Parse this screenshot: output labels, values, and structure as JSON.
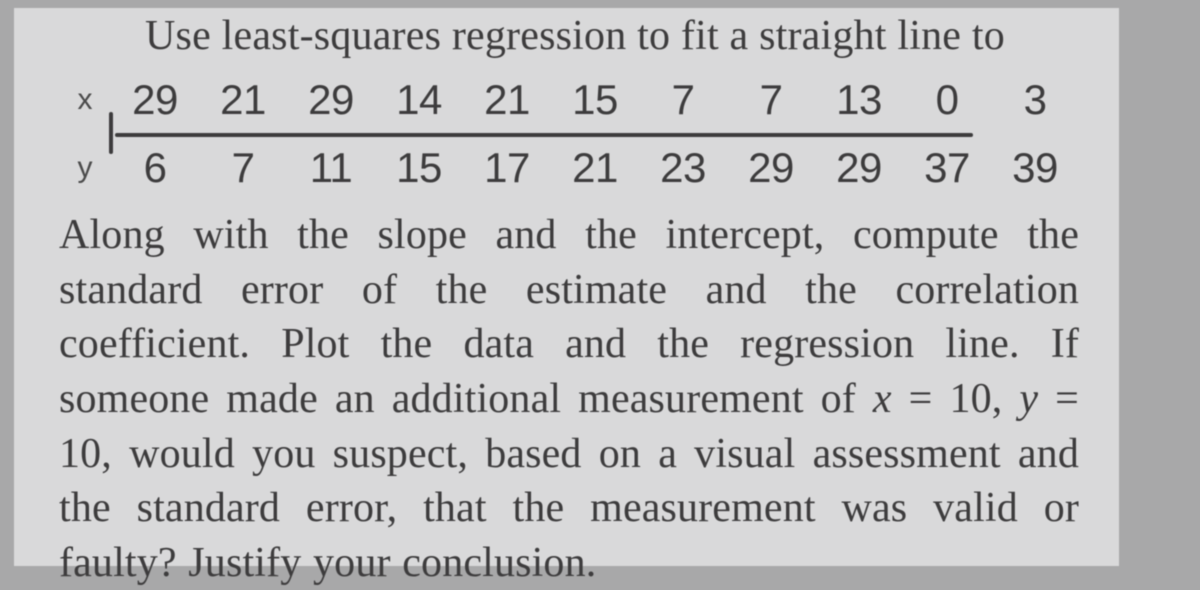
{
  "prompt": "Use least-squares regression to fit a straight line to",
  "row_labels": {
    "x": "x",
    "y": "y"
  },
  "table": {
    "x": [
      "29",
      "21",
      "29",
      "14",
      "21",
      "15",
      "7",
      "7",
      "13",
      "0",
      "3"
    ],
    "y": [
      "6",
      "7",
      "11",
      "15",
      "17",
      "21",
      "23",
      "29",
      "29",
      "37",
      "39"
    ]
  },
  "body_parts": [
    "Along with the slope and the intercept, compute the standard error of the estimate and the correlation coefficient. Plot the data and the re­gression line. If someone made an additional measurement of ",
    "x",
    " = 10, ",
    "y",
    " = 10, would you suspect, based on a visual assessment and the standard error, that the measurement was valid or faulty? Justify your conclusion."
  ],
  "chart_data": {
    "type": "table",
    "title": "Use least-squares regression to fit a straight line to",
    "series": [
      {
        "name": "x",
        "values": [
          29,
          21,
          29,
          14,
          21,
          15,
          7,
          7,
          13,
          0,
          3
        ]
      },
      {
        "name": "y",
        "values": [
          6,
          7,
          11,
          15,
          17,
          21,
          23,
          29,
          29,
          37,
          39
        ]
      }
    ],
    "question_point": {
      "x": 10,
      "y": 10
    }
  }
}
